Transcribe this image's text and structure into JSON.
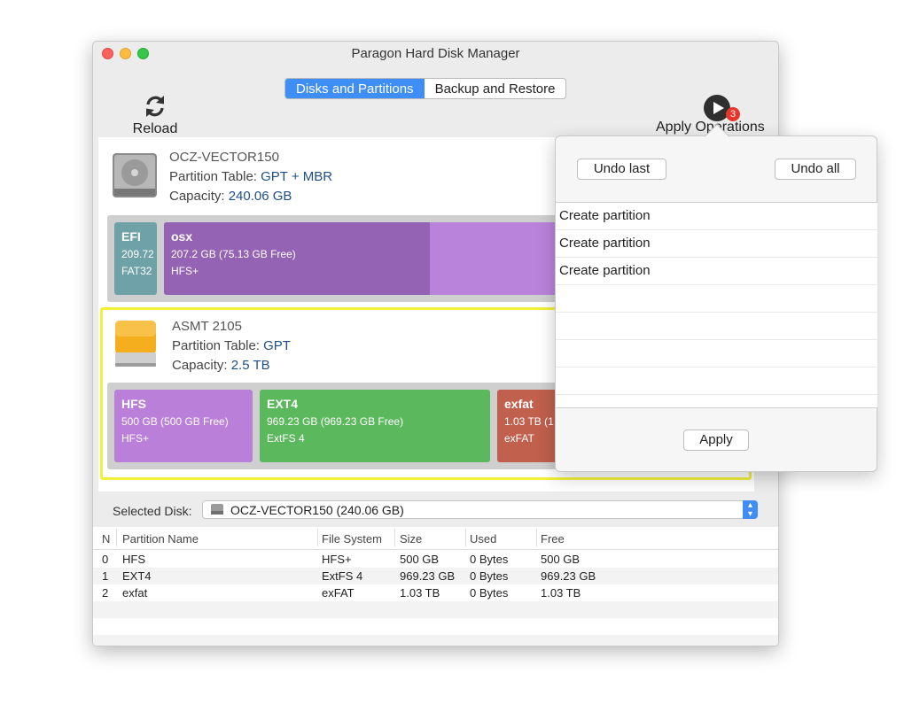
{
  "window": {
    "title": "Paragon Hard Disk Manager"
  },
  "tabs": [
    {
      "label": "Disks and Partitions",
      "active": true
    },
    {
      "label": "Backup and Restore",
      "active": false
    }
  ],
  "toolbar": {
    "reload_label": "Reload",
    "apply_label": "Apply Operations",
    "badge_count": "3"
  },
  "disks": [
    {
      "name": "OCZ-VECTOR150",
      "partition_table_label": "Partition Table:",
      "partition_table": "GPT + MBR",
      "capacity_label": "Capacity:",
      "capacity": "240.06 GB",
      "partitions": [
        {
          "name": "EFI",
          "size": "209.72",
          "fs": "FAT32",
          "color": "#6fa2a8"
        },
        {
          "name": "osx",
          "size": "207.2 GB (75.13 GB Free)",
          "fs": "HFS+",
          "color": "#9563b3",
          "free_color": "#b982db",
          "used_fraction": 0.64
        }
      ]
    },
    {
      "name": "ASMT 2105",
      "partition_table_label": "Partition Table:",
      "partition_table": "GPT",
      "capacity_label": "Capacity:",
      "capacity": "2.5 TB",
      "partitions": [
        {
          "name": "HFS",
          "size": "500 GB (500 GB Free)",
          "fs": "HFS+",
          "color": "#b97fd9"
        },
        {
          "name": "EXT4",
          "size": "969.23 GB (969.23 GB Free)",
          "fs": "ExtFS 4",
          "color": "#5cb85c"
        },
        {
          "name": "exfat",
          "size": "1.03 TB (1",
          "fs": "exFAT",
          "color": "#c0604d"
        }
      ]
    }
  ],
  "selected_disk": {
    "label": "Selected Disk:",
    "value": "OCZ-VECTOR150 (240.06 GB)"
  },
  "table": {
    "headers": [
      "N",
      "Partition Name",
      "File System",
      "Size",
      "Used",
      "Free"
    ],
    "rows": [
      [
        "0",
        "HFS",
        "HFS+",
        "500 GB",
        "0 Bytes",
        "500 GB"
      ],
      [
        "1",
        "EXT4",
        "ExtFS 4",
        "969.23 GB",
        "0 Bytes",
        "969.23 GB"
      ],
      [
        "2",
        "exfat",
        "exFAT",
        "1.03 TB",
        "0 Bytes",
        "1.03 TB"
      ]
    ]
  },
  "operations_popover": {
    "undo_last": "Undo last",
    "undo_all": "Undo all",
    "operations": [
      "Create partition",
      "Create partition",
      "Create partition"
    ],
    "apply": "Apply"
  }
}
